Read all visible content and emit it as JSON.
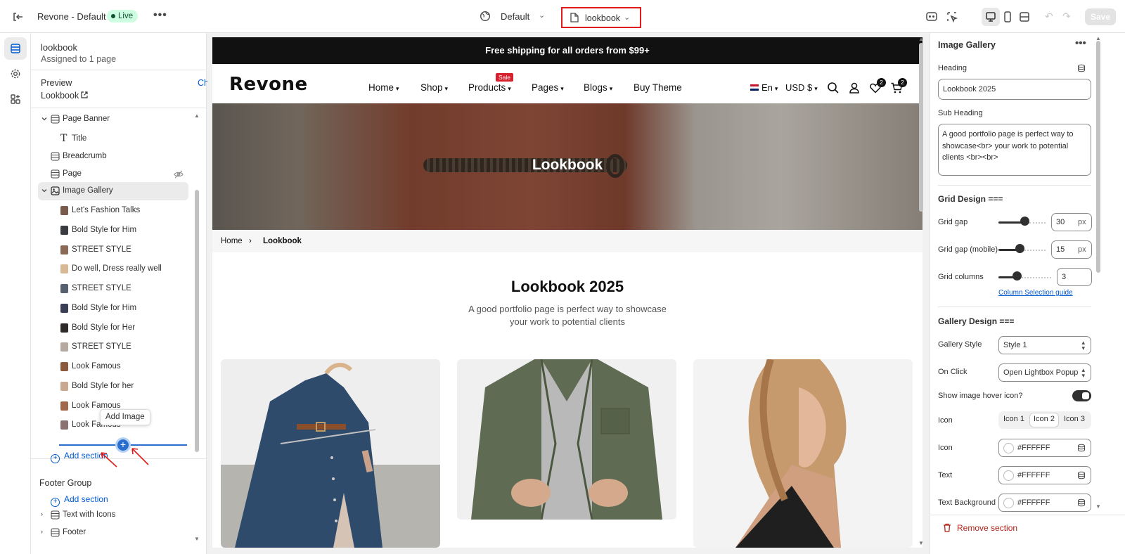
{
  "topbar": {
    "store_name": "Revone - Default",
    "live_label": "Live",
    "theme_label": "Default",
    "page_label": "lookbook",
    "save_label": "Save"
  },
  "left": {
    "page_title": "lookbook",
    "page_assigned": "Assigned to 1 page",
    "preview_label": "Preview",
    "change_label": "Change",
    "preview_value": "Lookbook",
    "tree": [
      {
        "label": "Page Banner",
        "kind": "section",
        "open": true
      },
      {
        "label": "Title",
        "kind": "text"
      },
      {
        "label": "Breadcrumb",
        "kind": "section"
      },
      {
        "label": "Page",
        "kind": "section",
        "hidden": true
      },
      {
        "label": "Image Gallery",
        "kind": "gallery",
        "open": true,
        "selected": true
      },
      {
        "label": "Let's Fashion Talks",
        "kind": "image"
      },
      {
        "label": "Bold Style for Him",
        "kind": "image"
      },
      {
        "label": "STREET STYLE",
        "kind": "image"
      },
      {
        "label": "Do well, Dress really well",
        "kind": "image"
      },
      {
        "label": "STREET STYLE",
        "kind": "image"
      },
      {
        "label": "Bold Style for Him",
        "kind": "image"
      },
      {
        "label": "Bold Style for Her",
        "kind": "image"
      },
      {
        "label": "STREET STYLE",
        "kind": "image"
      },
      {
        "label": "Look Famous",
        "kind": "image"
      },
      {
        "label": "Bold Style for her",
        "kind": "image"
      },
      {
        "label": "Look Famous",
        "kind": "image"
      },
      {
        "label": "Look Famous",
        "kind": "image"
      }
    ],
    "tooltip": "Add Image",
    "add_section": "Add section",
    "footer_group": "Footer Group",
    "footer_add_section": "Add section",
    "footer_items": [
      "Text with Icons",
      "Footer"
    ]
  },
  "site": {
    "announcement": "Free shipping for all orders from $99+",
    "logo": "Revone",
    "nav": [
      "Home",
      "Shop",
      "Products",
      "Pages",
      "Blogs",
      "Buy Theme"
    ],
    "sale_badge": "Sale",
    "language": "En",
    "currency": "USD $",
    "wishlist_count": "2",
    "cart_count": "2",
    "hero_title": "Lookbook",
    "breadcrumb_home": "Home",
    "breadcrumb_current": "Lookbook",
    "gallery_title": "Lookbook 2025",
    "gallery_sub_1": "A good portfolio page is perfect way to showcase",
    "gallery_sub_2": "your work to potential clients"
  },
  "right": {
    "title": "Image Gallery",
    "heading_label": "Heading",
    "heading_value": "Lookbook 2025",
    "subheading_label": "Sub Heading",
    "subheading_value": "A good portfolio page is perfect way to showcase<br>  your work to potential clients <br><br>",
    "grid_design": "Grid Design ===",
    "grid_gap_label": "Grid gap",
    "grid_gap_value": "30",
    "grid_gap_unit": "px",
    "grid_gap_fraction": 0.55,
    "grid_gap_mobile_label": "Grid gap (mobile)",
    "grid_gap_mobile_value": "15",
    "grid_gap_mobile_unit": "px",
    "grid_gap_mobile_fraction": 0.45,
    "grid_columns_label": "Grid columns",
    "grid_columns_value": "3",
    "grid_columns_fraction": 0.35,
    "column_guide": "Column Selection guide",
    "gallery_design": "Gallery Design ===",
    "gallery_style_label": "Gallery Style",
    "gallery_style_value": "Style 1",
    "on_click_label": "On Click",
    "on_click_value": "Open Lightbox Popup",
    "hover_icon_label": "Show image hover icon?",
    "hover_icon_on": true,
    "icon_label": "Icon",
    "icon_options": [
      "Icon 1",
      "Icon 2",
      "Icon 3"
    ],
    "icon_selected": "Icon 2",
    "icon_color_label": "Icon",
    "icon_color": "#FFFFFF",
    "text_color_label": "Text",
    "text_color": "#FFFFFF",
    "text_bg_label": "Text Background",
    "text_bg_color": "#FFFFFF",
    "remove_section": "Remove section"
  },
  "colors": {
    "accent": "#005bd3",
    "live_bg": "#cdfee1",
    "highlight_border": "#e01b1b",
    "sale": "#d6202e",
    "danger": "#b42318"
  }
}
